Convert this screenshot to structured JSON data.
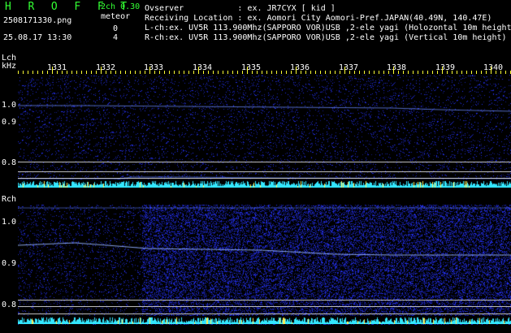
{
  "header": {
    "app_title": "H R O F F T",
    "version": "2ch 0.30",
    "meteor_label": "meteor",
    "filename": "2508171330.png",
    "datetime": "25.08.17 13:30",
    "meteor_count_l": "0",
    "meteor_count_r": "4"
  },
  "info": {
    "observer": "Ovserver           : ex. JR7CYX [ kid ]",
    "location": "Receiving Location : ex. Aomori City Aomori-Pref.JAPAN(40.49N, 140.47E)",
    "lch": "L-ch:ex. UV5R 113.900Mhz(SAPPORO VOR)USB ,2-ele yagi (Holozontal 10m height)",
    "rch": "R-ch:ex. UV5R 113.900Mhz(SAPPORO VOR)USB ,2-ele yagi (Vertical 10m height)"
  },
  "axis": {
    "lch_label": "Lch",
    "unit_label": "kHz",
    "rch_label": "Rch",
    "time_ticks": [
      "1331",
      "1332",
      "1333",
      "1334",
      "1335",
      "1336",
      "1337",
      "1338",
      "1339",
      "1340"
    ],
    "lch_freq_ticks": [
      "1.0",
      "0.9",
      "0.8"
    ],
    "rch_freq_ticks": [
      "1.0",
      "0.9",
      "0.8"
    ]
  },
  "colors": {
    "background": "#000000",
    "title_green": "#33ff33",
    "tick_yellow": "#ffff33",
    "noise_blue": "#1a2ad0",
    "spectrum_cyan": "#33e6ff"
  }
}
